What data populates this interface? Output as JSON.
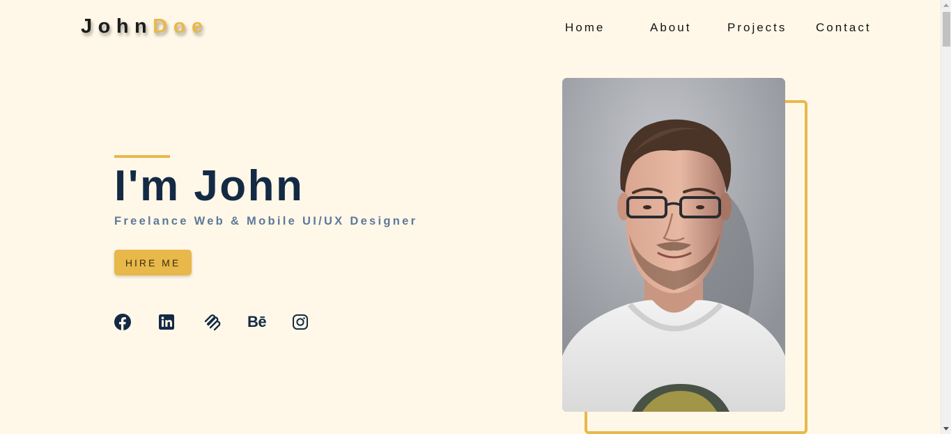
{
  "logo": {
    "first": "John",
    "last": "Doe"
  },
  "nav": {
    "items": [
      {
        "label": "Home"
      },
      {
        "label": "About"
      },
      {
        "label": "Projects"
      },
      {
        "label": "Contact"
      }
    ]
  },
  "hero": {
    "title": "I'm John",
    "subtitle": "Freelance Web & Mobile UI/UX Designer",
    "cta_label": "HIRE ME"
  },
  "socials": [
    {
      "icon": "facebook-icon"
    },
    {
      "icon": "linkedin-icon"
    },
    {
      "icon": "squarespace-icon"
    },
    {
      "icon": "behance-icon",
      "text": "Bē"
    },
    {
      "icon": "instagram-icon"
    }
  ],
  "colors": {
    "background": "#fff8e9",
    "accent": "#e8b84a",
    "heading": "#142a44",
    "subtitle": "#5d7898"
  }
}
